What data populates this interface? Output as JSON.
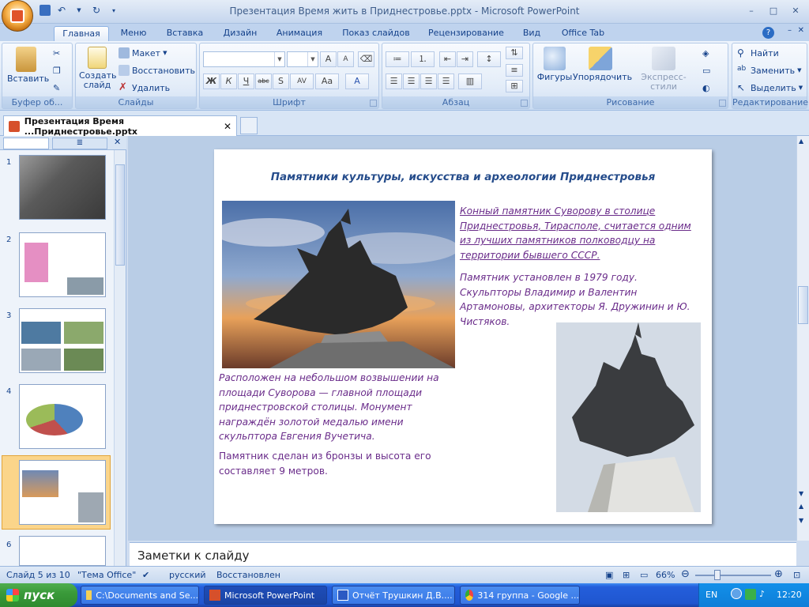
{
  "window": {
    "title": "Презентация  Время жить в Приднестровье.pptx - Microsoft PowerPoint",
    "minimize": "–",
    "maximize": "□",
    "close": "✕"
  },
  "tabs": [
    "Главная",
    "Меню",
    "Вставка",
    "Дизайн",
    "Анимация",
    "Показ слайдов",
    "Рецензирование",
    "Вид",
    "Office Tab"
  ],
  "ribbon": {
    "clipboard": {
      "paste": "Вставить",
      "label": "Буфер об..."
    },
    "slides": {
      "create": "Создать слайд",
      "layout": "Макет",
      "reset": "Восстановить",
      "delete": "Удалить",
      "label": "Слайды"
    },
    "font": {
      "label": "Шрифт",
      "bold": "Ж",
      "italic": "К",
      "underline": "Ч",
      "strike": "abc",
      "shadow": "S",
      "spacing": "AV",
      "case": "Aa",
      "grow": "A",
      "shrink": "A",
      "color": "A"
    },
    "paragraph": {
      "label": "Абзац"
    },
    "drawing": {
      "shapes": "Фигуры",
      "arrange": "Упорядочить",
      "styles": "Экспресс-стили",
      "label": "Рисование"
    },
    "editing": {
      "find": "Найти",
      "replace": "Заменить",
      "select": "Выделить",
      "label": "Редактирование"
    }
  },
  "doc_tab": "Презентация  Время ...Приднестровье.pptx",
  "slide_numbers": [
    "1",
    "2",
    "3",
    "4",
    "5",
    "6"
  ],
  "slide": {
    "title": "Памятники культуры, искусства и археологии Приднестровья",
    "para1": "Конный памятник Суворову в столице Приднестровья, Тирасполе, считается одним из лучших памятников полководцу на территории бывшего СССР.",
    "para2": "Памятник установлен в 1979 году. Скульпторы Владимир и Валентин Артамоновы, архитекторы Я. Дружинин и Ю. Чистяков.",
    "para3": "Расположен на небольшом возвышении на площади Суворова — главной площади приднестровской столицы. Монумент награждён золотой медалью имени скульптора Евгения Вучетича.",
    "para4": "Памятник сделан из бронзы и высота его составляет 9 метров."
  },
  "notes": "Заметки к слайду",
  "status": {
    "slide": "Слайд 5 из 10",
    "theme": "\"Тема Office\"",
    "lang": "русский",
    "state": "Восстановлен",
    "zoom": "66%"
  },
  "taskbar": {
    "start": "пуск",
    "items": [
      "C:\\Documents and Se...",
      "Microsoft PowerPoint",
      "Отчёт Трушкин Д.В....",
      "314 группа - Google ..."
    ],
    "lang": "EN",
    "time": "12:20"
  }
}
